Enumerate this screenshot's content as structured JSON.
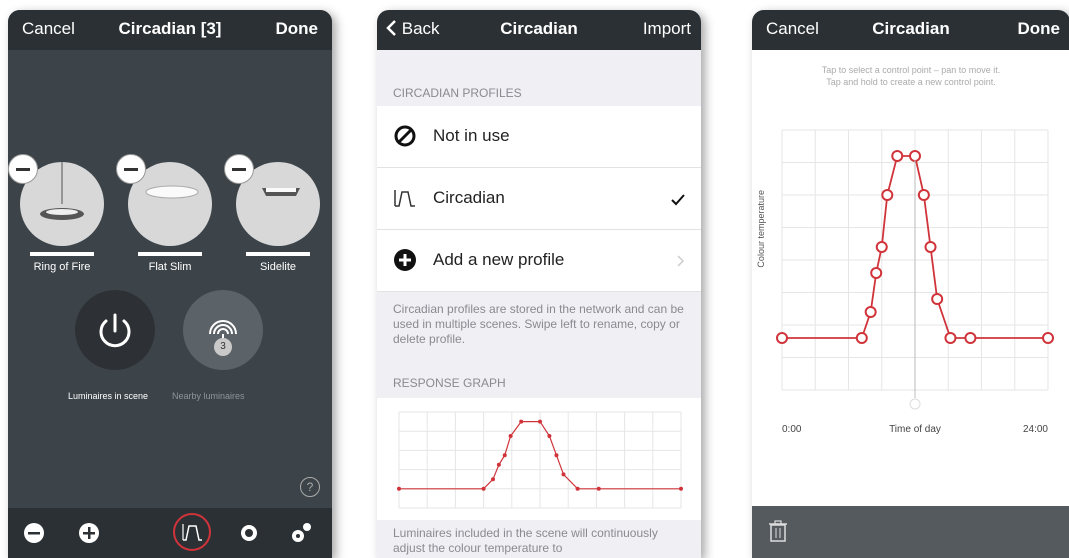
{
  "screen1": {
    "cancel": "Cancel",
    "title": "Circadian [3]",
    "done": "Done",
    "luminaires": [
      {
        "name": "Ring of Fire"
      },
      {
        "name": "Flat Slim"
      },
      {
        "name": "Sidelite"
      }
    ],
    "luminaires_in_scene": "Luminaires in scene",
    "nearby_luminaires": "Nearby luminaires",
    "nearby_count": "3",
    "help_icon": "?"
  },
  "screen2": {
    "back": "Back",
    "title": "Circadian",
    "import": "Import",
    "section_profiles": "CIRCADIAN PROFILES",
    "not_in_use": "Not in use",
    "circadian": "Circadian",
    "add_profile": "Add a new profile",
    "profiles_note": "Circadian profiles are stored in the network and can be used in multiple scenes. Swipe left to rename, copy or delete profile.",
    "section_graph": "RESPONSE GRAPH",
    "bottom_note": "Luminaires included in the scene will continuously adjust the colour temperature to"
  },
  "screen3": {
    "cancel": "Cancel",
    "title": "Circadian",
    "done": "Done",
    "hint_line1": "Tap to select a control point – pan to move it.",
    "hint_line2": "Tap and hold to create a new control point.",
    "y_label": "Colour temperature",
    "x_start": "0:00",
    "x_label": "Time of day",
    "x_end": "24:00"
  },
  "colors": {
    "accent": "#d0343a",
    "dark_bg": "#3d4449",
    "bar_bg": "#2b3034"
  },
  "chart_data": {
    "type": "line",
    "xlabel": "Time of day",
    "ylabel": "Colour temperature",
    "xlim": [
      0,
      24
    ],
    "ylim": [
      0,
      10
    ],
    "x": [
      0,
      7.2,
      8.0,
      8.5,
      9.0,
      9.5,
      10.4,
      12.0,
      12.8,
      13.4,
      14.0,
      15.2,
      17.0,
      24.0
    ],
    "y": [
      2.0,
      2.0,
      3.0,
      4.5,
      5.5,
      7.5,
      9.0,
      9.0,
      7.5,
      5.5,
      3.5,
      2.0,
      2.0,
      2.0
    ]
  }
}
